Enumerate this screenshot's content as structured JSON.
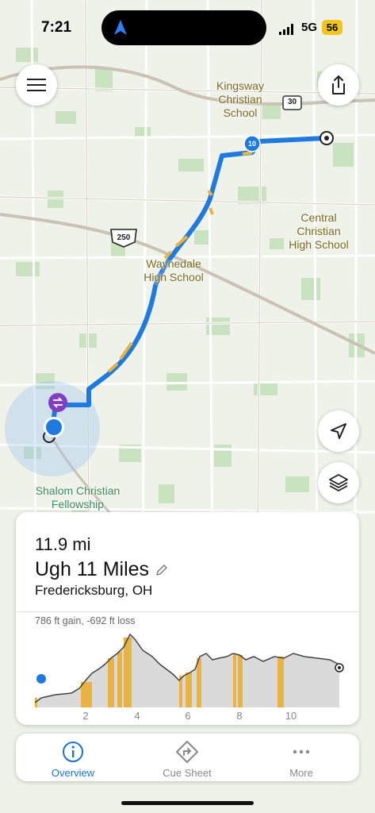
{
  "status_bar": {
    "time": "7:21",
    "network": "5G",
    "battery": "56"
  },
  "map": {
    "labels": {
      "kingsway": "Kingsway\nChristian\nSchool",
      "central": "Central\nChristian\nHigh School",
      "waynedale": "Waynedale\nHigh School",
      "shalom": "Shalom Christian\nFellowship"
    },
    "road_shields": {
      "us250": "250",
      "route30": "30",
      "route10": "10"
    }
  },
  "route_card": {
    "distance": "11.9 mi",
    "name": "Ugh 11 Miles",
    "location": "Fredericksburg, OH",
    "elevation_summary": "786 ft gain, -692 ft loss",
    "axis_ticks": [
      "2",
      "4",
      "6",
      "8",
      "10"
    ]
  },
  "tabs": [
    {
      "label": "Overview",
      "icon": "info-icon",
      "active": true
    },
    {
      "label": "Cue Sheet",
      "icon": "turn-sign-icon",
      "active": false
    },
    {
      "label": "More",
      "icon": "more-dots-icon",
      "active": false
    }
  ],
  "colors": {
    "route_blue": "#1f7ae0",
    "climb_yellow": "#e9b343",
    "accent": "#1a72d9"
  }
}
